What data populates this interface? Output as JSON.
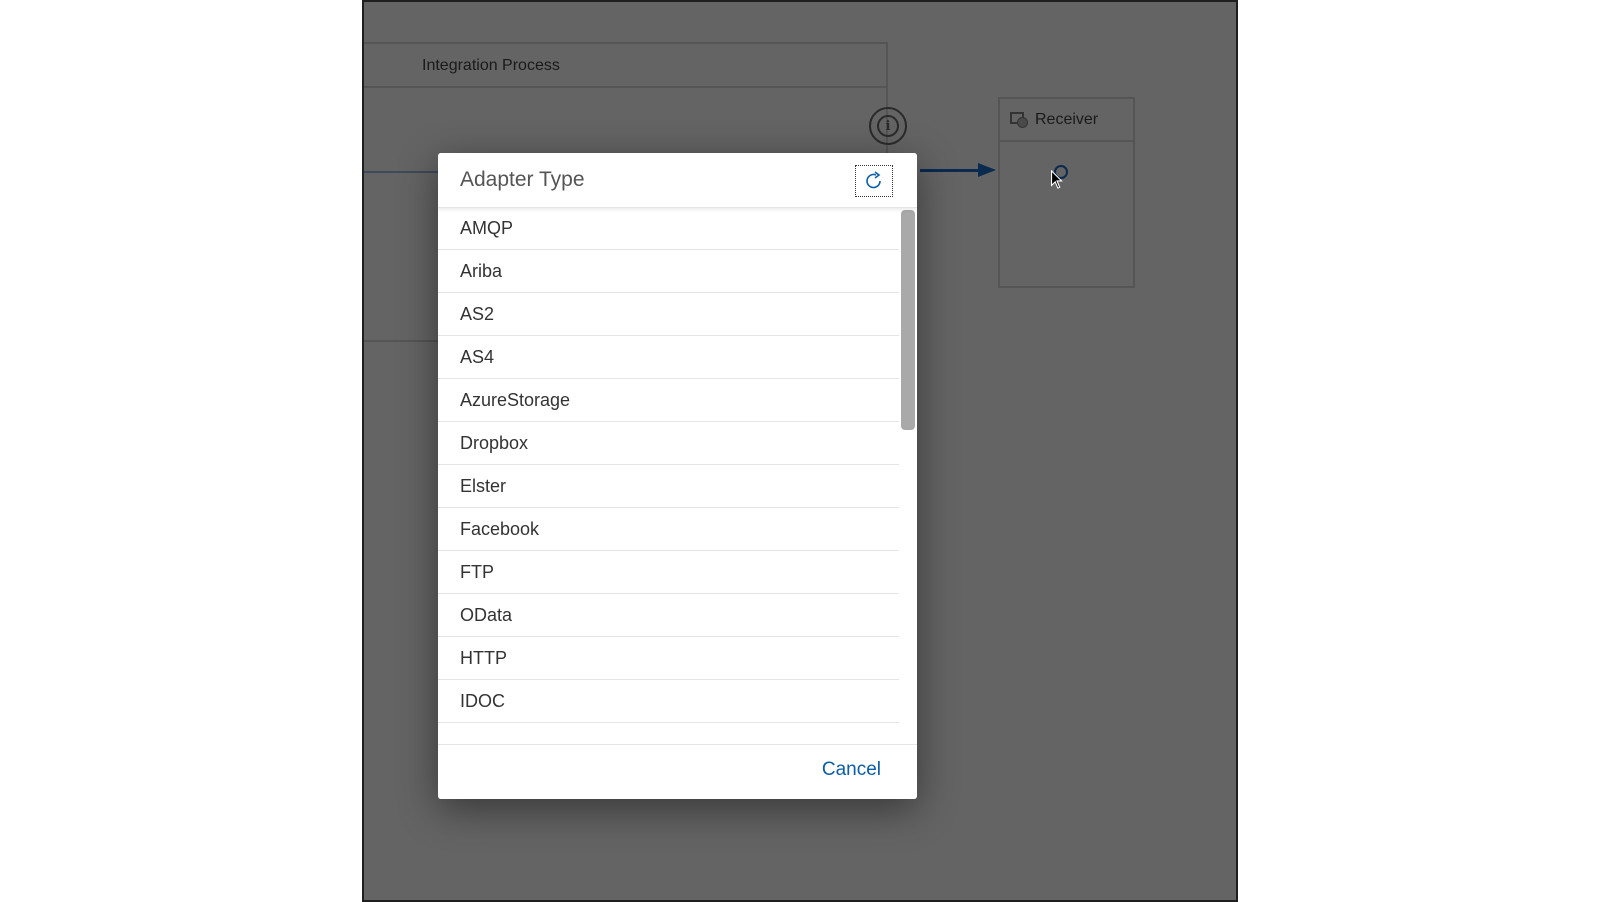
{
  "canvas": {
    "pool_title": "Integration Process",
    "receiver_label": "Receiver"
  },
  "dialog": {
    "title": "Adapter Type",
    "items": [
      {
        "label": "AMQP"
      },
      {
        "label": "Ariba"
      },
      {
        "label": "AS2"
      },
      {
        "label": "AS4"
      },
      {
        "label": "AzureStorage"
      },
      {
        "label": "Dropbox"
      },
      {
        "label": "Elster"
      },
      {
        "label": "Facebook"
      },
      {
        "label": "FTP"
      },
      {
        "label": "OData"
      },
      {
        "label": "HTTP"
      },
      {
        "label": "IDOC"
      }
    ],
    "cancel_label": "Cancel"
  },
  "colors": {
    "accent": "#0a5ea8",
    "overlay": "#646464"
  }
}
